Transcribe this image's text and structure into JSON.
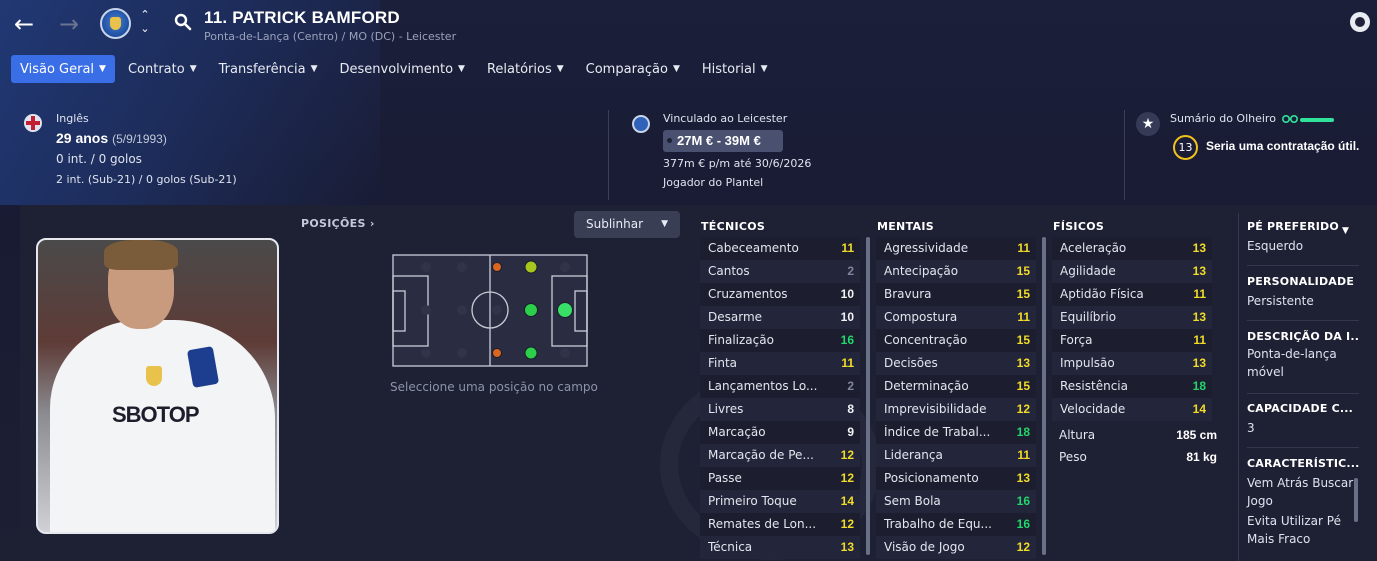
{
  "nav": {
    "back_icon": "arrow-left-icon",
    "forward_icon": "arrow-right-icon",
    "club_switch_up": "⌃",
    "club_switch_down": "⌄"
  },
  "player": {
    "title": "11. PATRICK BAMFORD",
    "subtitle": "Ponta-de-Lança (Centro) / MO (DC) - Leicester"
  },
  "tabs": [
    {
      "label": "Visão Geral",
      "active": true
    },
    {
      "label": "Contrato"
    },
    {
      "label": "Transferência"
    },
    {
      "label": "Desenvolvimento"
    },
    {
      "label": "Relatórios"
    },
    {
      "label": "Comparação"
    },
    {
      "label": "Historial"
    }
  ],
  "bio": {
    "nationality": "Inglês",
    "age": "29 anos",
    "dob": "(5/9/1993)",
    "caps": "0 int. / 0 golos",
    "caps_u21": "2 int. (Sub-21) / 0 golos (Sub-21)"
  },
  "contract": {
    "club": "Vinculado ao Leicester",
    "value": "27M € - 39M €",
    "wage": "377m € p/m até 30/6/2026",
    "status": "Jogador do Plantel"
  },
  "scout": {
    "title": "Sumário do Olheiro",
    "rating": "13",
    "summary": "Seria uma contratação útil."
  },
  "positions": {
    "label": "POSIÇÕES",
    "highlight_label": "Sublinhar",
    "hint": "Seleccione uma posição no campo"
  },
  "technical": {
    "header": "TÉCNICOS",
    "rows": [
      {
        "name": "Cabeceamento",
        "value": "11",
        "color": "yellow"
      },
      {
        "name": "Cantos",
        "value": "2",
        "color": "grey"
      },
      {
        "name": "Cruzamentos",
        "value": "10",
        "color": "white"
      },
      {
        "name": "Desarme",
        "value": "10",
        "color": "white"
      },
      {
        "name": "Finalização",
        "value": "16",
        "color": "green"
      },
      {
        "name": "Finta",
        "value": "11",
        "color": "yellow"
      },
      {
        "name": "Lançamentos Lo...",
        "value": "2",
        "color": "grey"
      },
      {
        "name": "Livres",
        "value": "8",
        "color": "white"
      },
      {
        "name": "Marcação",
        "value": "9",
        "color": "white"
      },
      {
        "name": "Marcação de Pe...",
        "value": "12",
        "color": "yellow"
      },
      {
        "name": "Passe",
        "value": "12",
        "color": "yellow"
      },
      {
        "name": "Primeiro Toque",
        "value": "14",
        "color": "yellow"
      },
      {
        "name": "Remates de Lon...",
        "value": "12",
        "color": "yellow"
      },
      {
        "name": "Técnica",
        "value": "13",
        "color": "yellow"
      }
    ]
  },
  "mental": {
    "header": "MENTAIS",
    "rows": [
      {
        "name": "Agressividade",
        "value": "11",
        "color": "yellow"
      },
      {
        "name": "Antecipação",
        "value": "15",
        "color": "yellow"
      },
      {
        "name": "Bravura",
        "value": "15",
        "color": "yellow"
      },
      {
        "name": "Compostura",
        "value": "11",
        "color": "yellow"
      },
      {
        "name": "Concentração",
        "value": "15",
        "color": "yellow"
      },
      {
        "name": "Decisões",
        "value": "13",
        "color": "yellow"
      },
      {
        "name": "Determinação",
        "value": "15",
        "color": "yellow"
      },
      {
        "name": "Imprevisibilidade",
        "value": "12",
        "color": "yellow"
      },
      {
        "name": "Índice de Trabal...",
        "value": "18",
        "color": "green"
      },
      {
        "name": "Liderança",
        "value": "11",
        "color": "yellow"
      },
      {
        "name": "Posicionamento",
        "value": "13",
        "color": "yellow"
      },
      {
        "name": "Sem Bola",
        "value": "16",
        "color": "green"
      },
      {
        "name": "Trabalho de Equ...",
        "value": "16",
        "color": "green"
      },
      {
        "name": "Visão de Jogo",
        "value": "12",
        "color": "yellow"
      }
    ]
  },
  "physical": {
    "header": "FÍSICOS",
    "rows": [
      {
        "name": "Aceleração",
        "value": "13",
        "color": "yellow"
      },
      {
        "name": "Agilidade",
        "value": "13",
        "color": "yellow"
      },
      {
        "name": "Aptidão Física",
        "value": "11",
        "color": "yellow"
      },
      {
        "name": "Equilíbrio",
        "value": "13",
        "color": "yellow"
      },
      {
        "name": "Força",
        "value": "11",
        "color": "yellow"
      },
      {
        "name": "Impulsão",
        "value": "13",
        "color": "yellow"
      },
      {
        "name": "Resistência",
        "value": "18",
        "color": "green"
      },
      {
        "name": "Velocidade",
        "value": "14",
        "color": "yellow"
      }
    ],
    "height_label": "Altura",
    "height_value": "185 cm",
    "weight_label": "Peso",
    "weight_value": "81 kg"
  },
  "side": {
    "preferred_foot_h": "PÉ PREFERIDO",
    "preferred_foot_v": "Esquerdo",
    "personality_h": "PERSONALIDADE",
    "personality_v": "Persistente",
    "media_h": "DESCRIÇÃO DA I...",
    "media_v": "Ponta-de-lança móvel",
    "capacity_h": "CAPACIDADE C...",
    "capacity_v": "3",
    "traits_h": "CARACTERÍSTIC...",
    "trait1": "Vem Atrás Buscar Jogo",
    "trait2": "Evita Utilizar Pé Mais Fraco"
  },
  "colors": {
    "accent": "#3a6ee6",
    "attr_green": "#22d66b",
    "attr_yellow": "#f1dc28",
    "attr_grey": "#7f859b",
    "scout_ring": "#f0c21b"
  },
  "pitch_positions": [
    {
      "role": "MO(E)",
      "level": "poor",
      "color": "#d9661f"
    },
    {
      "role": "MO(D)",
      "level": "poor",
      "color": "#d9661f"
    },
    {
      "role": "AM(E)",
      "level": "moderate",
      "color": "#a8c51d"
    },
    {
      "role": "MO(C)",
      "level": "good",
      "color": "#2ccf4a"
    },
    {
      "role": "AM(D)",
      "level": "good",
      "color": "#2ccf4a"
    },
    {
      "role": "PL(C)",
      "level": "natural",
      "color": "#38e067"
    }
  ]
}
